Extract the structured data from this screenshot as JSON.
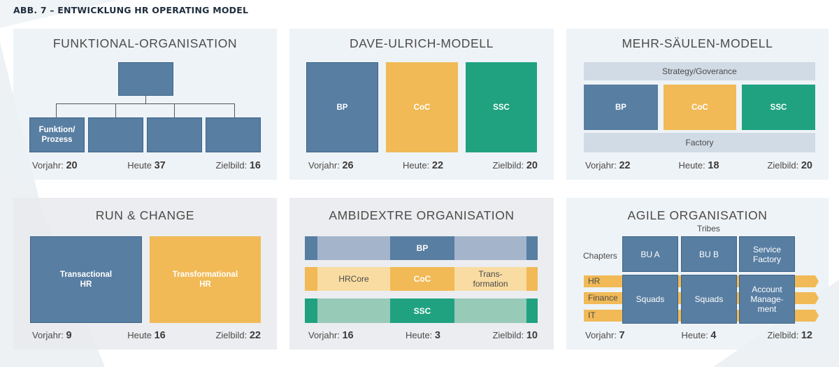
{
  "figure_title": "ABB. 7 – ENTWICKLUNG HR OPERATING MODEL",
  "colors": {
    "blue": "#587ea2",
    "yellow": "#f1ba56",
    "green": "#20a281",
    "panel_bg": "#eaf0f5",
    "light_bar": "#d1dbe5"
  },
  "panels": {
    "funktional": {
      "title": "FUNKTIONAL-ORGANISATION",
      "boxes": [
        "Funktion/\nProzess",
        "",
        "",
        ""
      ],
      "stats": {
        "vorjahr_label": "Vorjahr:",
        "vorjahr": "20",
        "heute_label": "Heute",
        "heute": "37",
        "ziel_label": "Zielbild:",
        "ziel": "16"
      }
    },
    "ulrich": {
      "title": "DAVE-ULRICH-MODELL",
      "boxes": [
        "BP",
        "CoC",
        "SSC"
      ],
      "stats": {
        "vorjahr_label": "Vorjahr:",
        "vorjahr": "26",
        "heute_label": "Heute:",
        "heute": "22",
        "ziel_label": "Zielbild:",
        "ziel": "20"
      }
    },
    "saeulen": {
      "title": "MEHR-SÄULEN-MODELL",
      "top_bar": "Strategy/Goverance",
      "boxes": [
        "BP",
        "CoC",
        "SSC"
      ],
      "bottom_bar": "Factory",
      "stats": {
        "vorjahr_label": "Vorjahr:",
        "vorjahr": "22",
        "heute_label": "Heute:",
        "heute": "18",
        "ziel_label": "Zielbild:",
        "ziel": "20"
      }
    },
    "runchange": {
      "title": "RUN & CHANGE",
      "boxes": [
        "Transactional\nHR",
        "Transformational\nHR"
      ],
      "stats": {
        "vorjahr_label": "Vorjahr:",
        "vorjahr": "9",
        "heute_label": "Heute",
        "heute": "16",
        "ziel_label": "Zielbild:",
        "ziel": "22"
      }
    },
    "ambidextre": {
      "title": "AMBIDEXTRE ORGANISATION",
      "rows": [
        {
          "left": "",
          "center": "BP",
          "right": ""
        },
        {
          "left": "HRCore",
          "center": "CoC",
          "right": "Trans-\nformation"
        },
        {
          "left": "",
          "center": "SSC",
          "right": ""
        }
      ],
      "stats": {
        "vorjahr_label": "Vorjahr:",
        "vorjahr": "16",
        "heute_label": "Heute:",
        "heute": "3",
        "ziel_label": "Zielbild:",
        "ziel": "10"
      }
    },
    "agile": {
      "title": "AGILE ORGANISATION",
      "tribes_label": "Tribes",
      "chapters_label": "Chapters",
      "tribes": [
        "BU A",
        "BU B",
        "Service\nFactory"
      ],
      "chapters": [
        "HR",
        "Finance",
        "IT"
      ],
      "squads": [
        "Squads",
        "Squads",
        "Account\nManage-\nment"
      ],
      "stats": {
        "vorjahr_label": "Vorjahr:",
        "vorjahr": "7",
        "heute_label": "Heute:",
        "heute": "4",
        "ziel_label": "Zielbild:",
        "ziel": "12"
      }
    }
  }
}
